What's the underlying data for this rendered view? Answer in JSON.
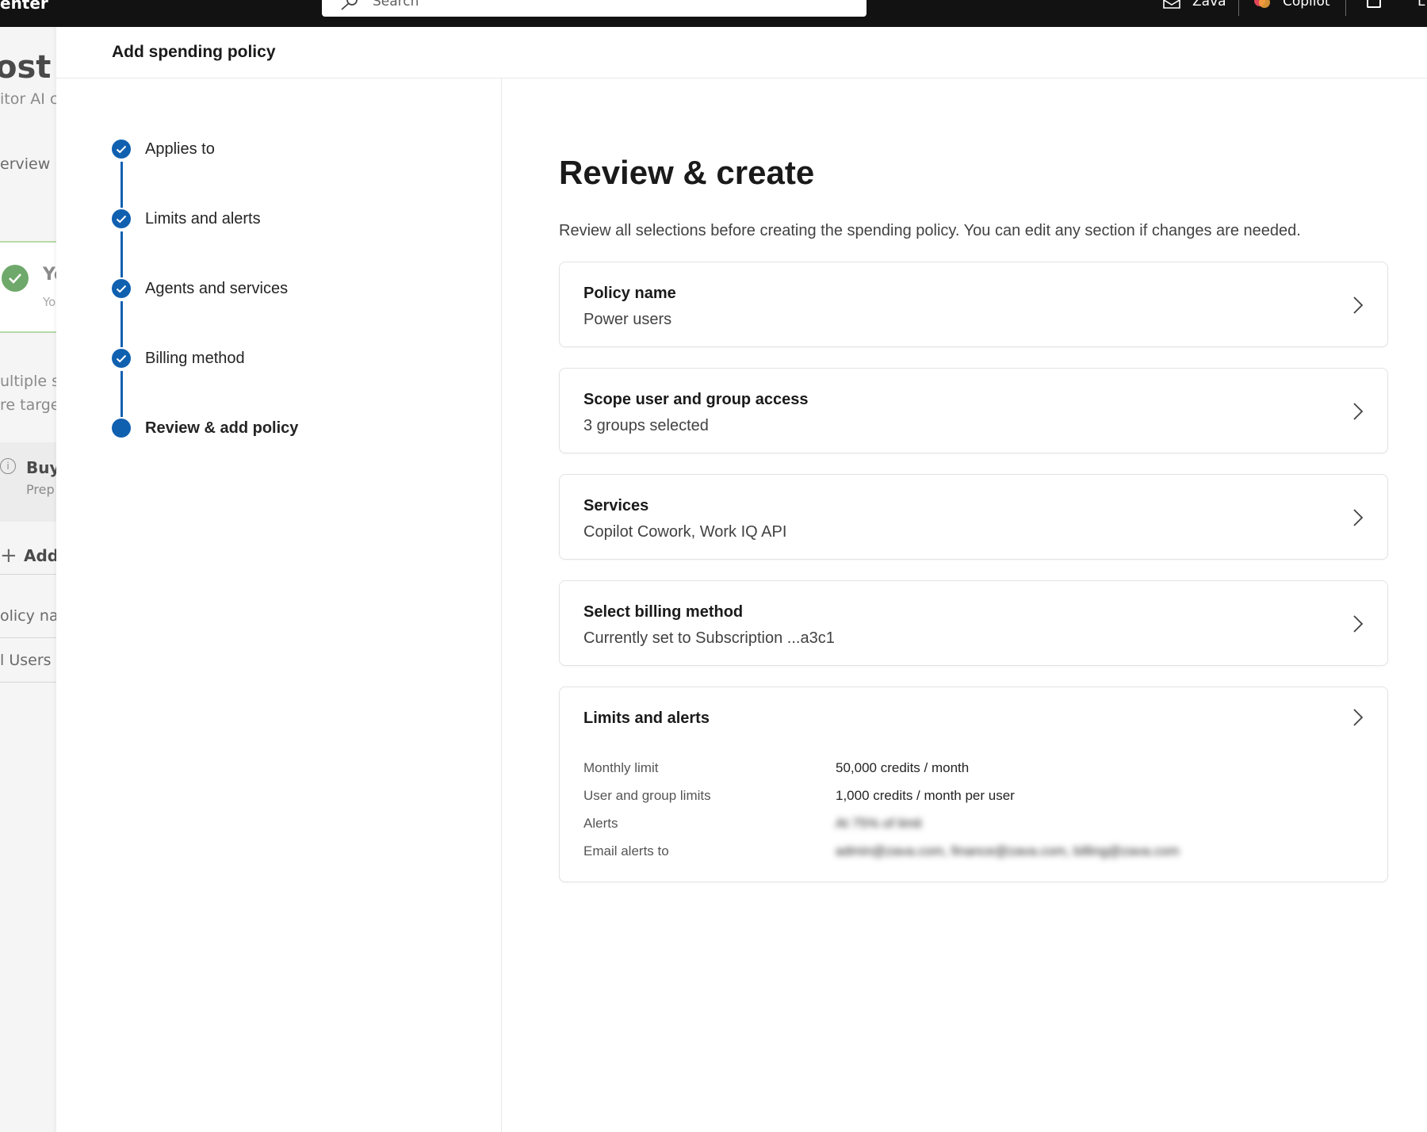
{
  "topbar": {
    "app_name": "enter",
    "search_placeholder": "Search",
    "org_name": "Zava",
    "copilot_label": "Copilot",
    "extra_label": "L"
  },
  "background_page": {
    "title": "ost m",
    "subtitle": "itor AI c",
    "nav_overview": "erview",
    "card_title": "Yo",
    "card_sub": "Yo",
    "text_multiple": "ultiple s",
    "text_targe": "re targe",
    "buy_label": "Buy",
    "prep_label": "Prep",
    "add_label": "Add",
    "policy_name_col": "olicy nan",
    "users_row": "l Users P"
  },
  "panel": {
    "title": "Add spending policy"
  },
  "steps": [
    {
      "label": "Applies to",
      "status": "completed"
    },
    {
      "label": "Limits and alerts",
      "status": "completed"
    },
    {
      "label": "Agents and services",
      "status": "completed"
    },
    {
      "label": "Billing method",
      "status": "completed"
    },
    {
      "label": "Review & add policy",
      "status": "current"
    }
  ],
  "review": {
    "heading": "Review & create",
    "description": "Review all selections before creating the spending policy. You can edit any section if changes are needed.",
    "cards": [
      {
        "title": "Policy name",
        "value": "Power users"
      },
      {
        "title": "Scope user and group access",
        "value": "3 groups selected"
      },
      {
        "title": "Services",
        "value": "Copilot Cowork, Work IQ API"
      },
      {
        "title": "Select billing method",
        "value": "Currently set to Subscription ...a3c1"
      }
    ],
    "limits_card": {
      "title": "Limits and alerts",
      "rows": [
        {
          "label": "Monthly limit",
          "value": "50,000 credits / month"
        },
        {
          "label": "User and group limits",
          "value": "1,000 credits / month per user"
        },
        {
          "label": "Alerts",
          "value": "At 75% of limit"
        },
        {
          "label": "Email alerts to",
          "value": "admin@zava.com, finance@zava.com, billing@zava.com"
        }
      ]
    }
  },
  "colors": {
    "accent": "#1060b0",
    "topbar_bg": "#121212",
    "success": "#6ea86a"
  },
  "icons": {
    "search": "search-icon",
    "step_done": "checkmark-icon",
    "chevron": "chevron-right-icon"
  }
}
